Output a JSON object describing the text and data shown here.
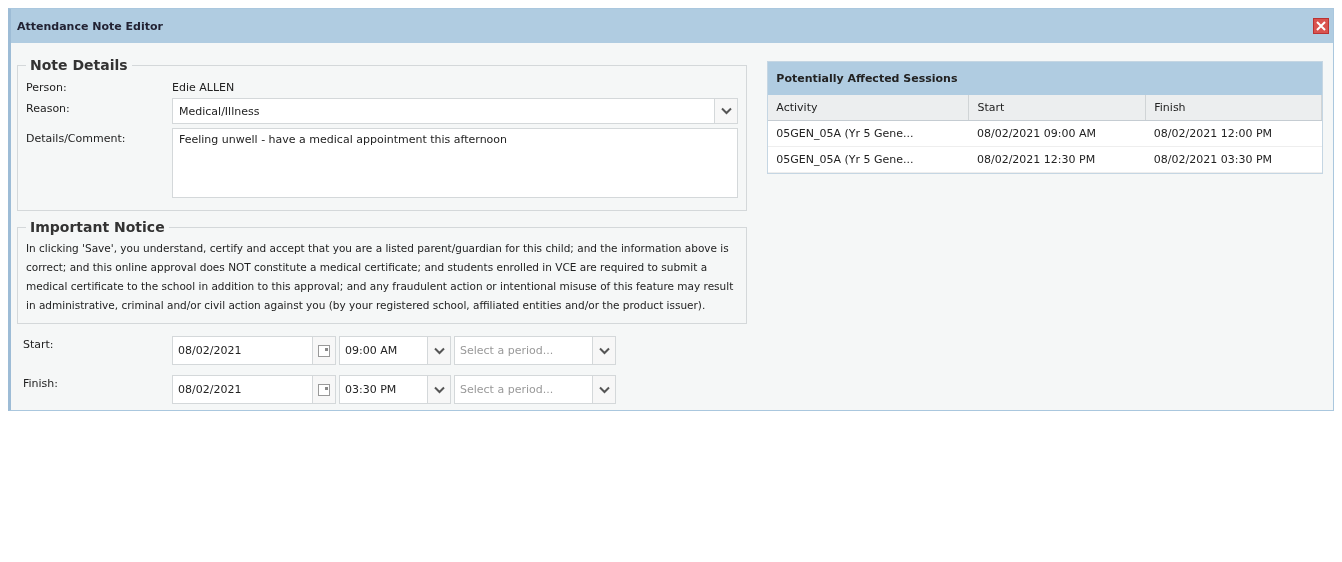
{
  "window": {
    "title": "Attendance Note Editor"
  },
  "note_details": {
    "legend": "Note Details",
    "fields": [
      {
        "label": "Person:",
        "kind": "text",
        "value": "Edie ALLEN"
      },
      {
        "label": "Reason:",
        "kind": "select",
        "value": "Medical/Illness"
      },
      {
        "label": "Details/Comment:",
        "kind": "textarea",
        "value": "Feeling unwell - have a medical appointment this afternoon"
      }
    ]
  },
  "important_notice": {
    "legend": "Important Notice",
    "text": "In clicking 'Save', you understand, certify and accept that you are a listed parent/guardian for this child; and the information above is correct; and this online approval does NOT constitute a medical certificate; and students enrolled in VCE are required to submit a medical certificate to the school in addition to this approval; and any fraudulent action or intentional misuse of this feature may result in administrative, criminal and/or civil action against you (by your registered school, affiliated entities and/or the product issuer)."
  },
  "times": [
    {
      "label": "Start:",
      "date": "08/02/2021",
      "time": "09:00 AM",
      "period_placeholder": "Select a period..."
    },
    {
      "label": "Finish:",
      "date": "08/02/2021",
      "time": "03:30 PM",
      "period_placeholder": "Select a period..."
    }
  ],
  "sessions": {
    "title": "Potentially Affected Sessions",
    "columns": [
      "Activity",
      "Start",
      "Finish"
    ],
    "rows": [
      [
        "05GEN_05A (Yr 5 Gene...",
        "08/02/2021 09:00 AM",
        "08/02/2021 12:00 PM"
      ],
      [
        "05GEN_05A (Yr 5 Gene...",
        "08/02/2021 12:30 PM",
        "08/02/2021 03:30 PM"
      ]
    ]
  }
}
